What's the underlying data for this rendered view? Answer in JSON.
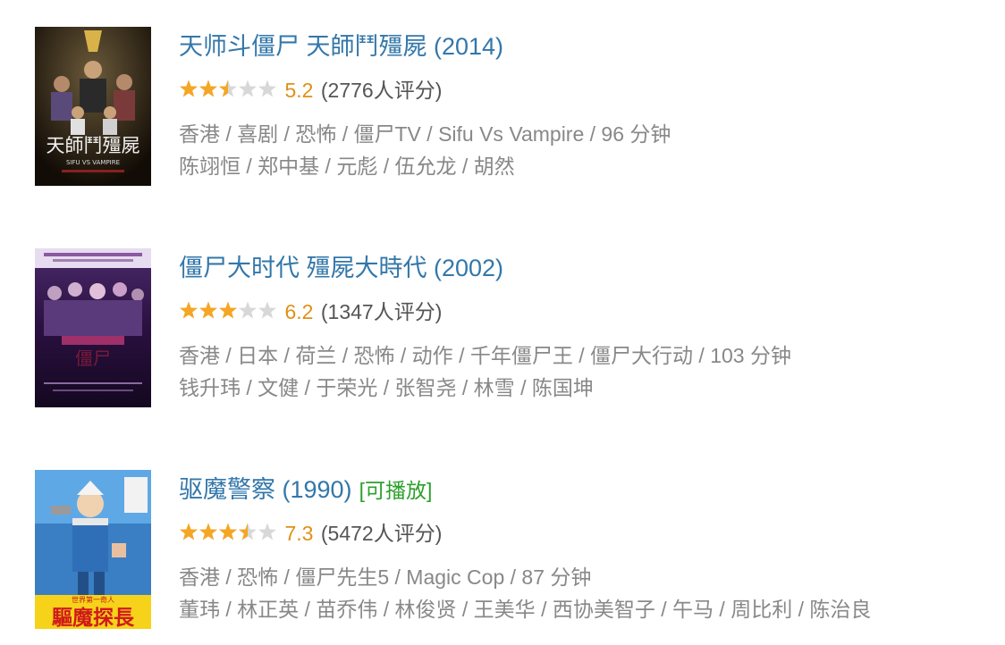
{
  "movies": [
    {
      "title": "天师斗僵尸 天師鬥殭屍 (2014)",
      "rating_score": "5.2",
      "rating_fraction": 0.52,
      "votes_text": "(2776人评分)",
      "playable_label": "",
      "info_line": "香港 / 喜剧 / 恐怖 / 僵尸TV / Sifu Vs Vampire / 96 分钟",
      "cast_line": "陈翊恒 / 郑中基 / 元彪 / 伍允龙 / 胡然",
      "poster_text": "天師鬥殭屍",
      "poster_subtext": "SIFU VS VAMPIRE"
    },
    {
      "title": "僵尸大时代 殭屍大時代 (2002)",
      "rating_score": "6.2",
      "rating_fraction": 0.62,
      "votes_text": "(1347人评分)",
      "playable_label": "",
      "info_line": "香港 / 日本 / 荷兰 / 恐怖 / 动作 / 千年僵尸王 / 僵尸大行动 / 103 分钟",
      "cast_line": "钱升玮 / 文健 / 于荣光 / 张智尧 / 林雪 / 陈国坤",
      "poster_text": "",
      "poster_subtext": ""
    },
    {
      "title": "驱魔警察 (1990)",
      "rating_score": "7.3",
      "rating_fraction": 0.73,
      "votes_text": "(5472人评分)",
      "playable_label": "[可播放]",
      "info_line": "香港 / 恐怖 / 僵尸先生5 / Magic Cop / 87 分钟",
      "cast_line": "董玮 / 林正英 / 苗乔伟 / 林俊贤 / 王美华 / 西协美智子 / 午马 / 周比利 / 陈治良",
      "poster_text": "驅魔探長",
      "poster_subtext": "世界第一奇人"
    }
  ],
  "colors": {
    "title": "#3377aa",
    "star_on": "#f5a623",
    "star_off": "#d8d8d8",
    "score": "#e09015",
    "playable": "#2ca02c",
    "meta": "#888888"
  }
}
